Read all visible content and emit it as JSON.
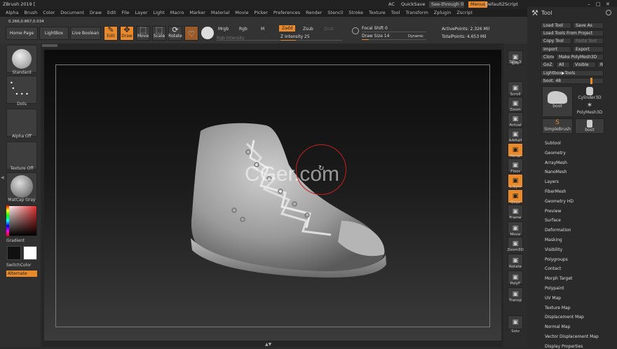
{
  "title_bar": {
    "app_title": "ZBrush 2019 [",
    "ac": "AC",
    "quicksave": "QuickSave",
    "see_through": "See-through  0",
    "menus": "Menus",
    "script": "Default2Script"
  },
  "menu_bar": [
    "Alpha",
    "Brush",
    "Color",
    "Document",
    "Draw",
    "Edit",
    "File",
    "Layer",
    "Light",
    "Macro",
    "Marker",
    "Material",
    "Movie",
    "Picker",
    "Preferences",
    "Render",
    "Stencil",
    "Stroke",
    "Texture",
    "Tool",
    "Transform",
    "Zplugin",
    "Zscript"
  ],
  "toolbar": {
    "coords": "0.266,0.867,0.034",
    "home_page": "Home Page",
    "lightbox": "LightBox",
    "live_boolean": "Live Boolean",
    "edit": "Edit",
    "draw": "Draw",
    "move": "Move",
    "scale": "Scale",
    "rotate": "Rotate",
    "mrgb": "Mrgb",
    "rgb": "Rgb",
    "m": "M",
    "zadd": "Zadd",
    "zsub": "Zsub",
    "zcut": "Zcut",
    "rgb_intensity": "Rgb Intensity",
    "z_intensity": "Z Intensity 25",
    "focal_shift": "Focal Shift 0",
    "draw_size": "Draw Size 14",
    "dynamic": "Dynamic",
    "active_points": "ActivePoints: 2.326 Mil",
    "total_points": "TotalPoints: 4.653 Mil"
  },
  "left_panel": {
    "brush": "Standard",
    "stroke": "Dots",
    "alpha": "Alpha Off",
    "texture": "Texture Off",
    "material": "MatCap Gray",
    "gradient": "Gradient",
    "switch_color": "SwitchColor",
    "alternate": "Alternate"
  },
  "watermark": "CGer.com",
  "right_shelf": [
    {
      "label": "BPR",
      "name": "bpr"
    },
    {
      "label": "SPix 3",
      "name": "spix"
    },
    {
      "label": "Scroll",
      "name": "scroll"
    },
    {
      "label": "Zoom",
      "name": "zoom"
    },
    {
      "label": "Actual",
      "name": "actual"
    },
    {
      "label": "AAHalf",
      "name": "aahalf"
    },
    {
      "label": "Persp",
      "name": "persp"
    },
    {
      "label": "Floor",
      "name": "floor"
    },
    {
      "label": "L.Sym",
      "name": "lsym"
    },
    {
      "label": "Qxyz",
      "name": "qxyz"
    },
    {
      "label": "Frame",
      "name": "frame"
    },
    {
      "label": "Move",
      "name": "move"
    },
    {
      "label": "Zoom3D",
      "name": "zoom3d"
    },
    {
      "label": "Rotate",
      "name": "rotate"
    },
    {
      "label": "PolyF",
      "name": "polyf"
    },
    {
      "label": "Transp",
      "name": "transp"
    },
    {
      "label": "Solo",
      "name": "solo"
    }
  ],
  "tool_panel": {
    "title": "Tool",
    "load_tool": "Load Tool",
    "save_as": "Save As",
    "load_from_project": "Load Tools From Project",
    "copy_tool": "Copy Tool",
    "paste_tool": "Paste Tool",
    "import": "Import",
    "export": "Export",
    "clone": "Clone",
    "make_polymesh": "Make PolyMesh3D",
    "goz": "GoZ",
    "all": "All",
    "visible": "Visible",
    "r": "R",
    "lightbox_tools": "Lightbox▶Tools",
    "boot_value": "boot. 48",
    "thumbs": [
      "boot",
      "Cylinder3D",
      "PolyMesh3D",
      "SimpleBrush",
      "boot"
    ],
    "subpalettes": [
      "Subtool",
      "Geometry",
      "ArrayMesh",
      "NanoMesh",
      "Layers",
      "FiberMesh",
      "Geometry HD",
      "Preview",
      "Surface",
      "Deformation",
      "Masking",
      "Visibility",
      "Polygroups",
      "Contact",
      "Morph Target",
      "Polypaint",
      "UV Map",
      "Texture Map",
      "Displacement Map",
      "Normal Map",
      "Vector Displacement Map",
      "Display Properties"
    ]
  },
  "colors": {
    "accent": "#e8892b",
    "background": "#2b2b2b"
  }
}
